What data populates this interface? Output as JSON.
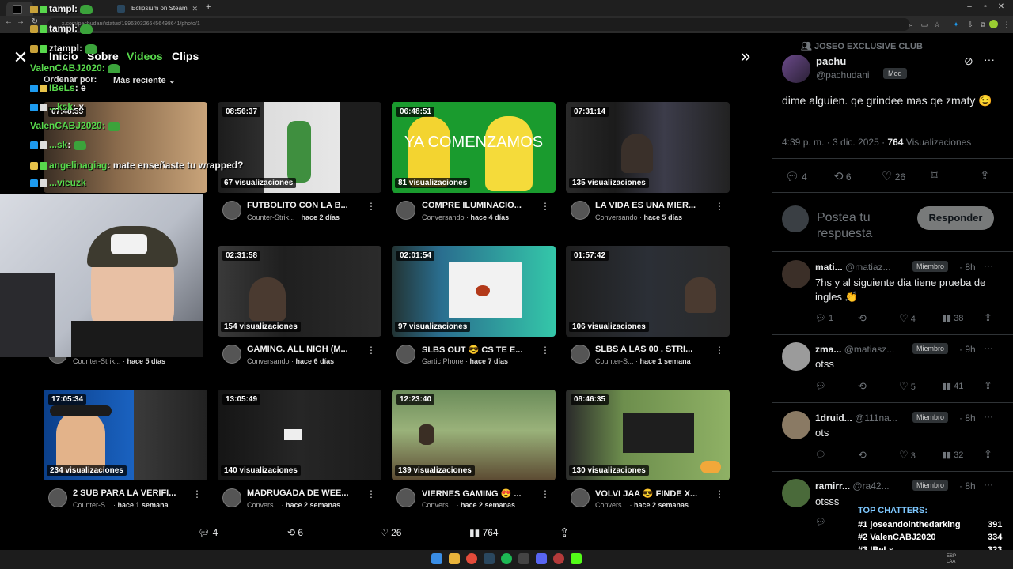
{
  "browser": {
    "tabs": [
      {
        "label": "...",
        "active": true
      },
      {
        "label": "Eclipsium on Steam",
        "active": false
      }
    ],
    "url": "x.com/pachudani/status/1996303266456498641/photo/1",
    "new_tab": "+"
  },
  "overlay": {
    "nav_tabs": [
      "Inicio",
      "Sobre",
      "Videos",
      "Clips"
    ],
    "active_tab": "Videos",
    "sort_label": "Ordenar por:",
    "sort_value": "Más reciente",
    "videos": [
      {
        "duration": "07:48:55",
        "views": "",
        "title": "",
        "channel": "",
        "age": ""
      },
      {
        "duration": "08:56:37",
        "views": "67 visualizaciones",
        "title": "FUTBOLITO CON LA B...",
        "channel": "Counter-Strik...",
        "age": "hace 2 días"
      },
      {
        "duration": "06:48:51",
        "views": "81 visualizaciones",
        "title": "COMPRE ILUMINACIO...",
        "channel": "Conversando",
        "age": "hace 4 días",
        "overlay_text": "YA COMENZAMOS"
      },
      {
        "duration": "07:31:14",
        "views": "135 visualizaciones",
        "title": "LA VIDA ES UNA MIER...",
        "channel": "Conversando",
        "age": "hace 5 días"
      },
      {
        "duration": "",
        "views": "",
        "title": "",
        "channel": "Counter-Strik...",
        "age": "hace 5 días"
      },
      {
        "duration": "02:31:58",
        "views": "154 visualizaciones",
        "title": "GAMING. ALL NIGH (M...",
        "channel": "Conversando",
        "age": "hace 6 días"
      },
      {
        "duration": "02:01:54",
        "views": "97 visualizaciones",
        "title": "SLBS OUT 😎 CS TE E...",
        "channel": "Gartic Phone",
        "age": "hace 7 días"
      },
      {
        "duration": "01:57:42",
        "views": "106 visualizaciones",
        "title": "SLBS A LAS 00 . STRI...",
        "channel": "Counter-S...",
        "age": "hace 1 semana"
      },
      {
        "duration": "17:05:34",
        "views": "234 visualizaciones",
        "title": "2 SUB PARA LA VERIFI...",
        "channel": "Counter-S...",
        "age": "hace 1 semana"
      },
      {
        "duration": "13:05:49",
        "views": "140 visualizaciones",
        "title": "MADRUGADA DE WEE...",
        "channel": "Convers...",
        "age": "hace 2 semanas"
      },
      {
        "duration": "12:23:40",
        "views": "139 visualizaciones",
        "title": "VIERNES GAMING 😍 ...",
        "channel": "Convers...",
        "age": "hace 2 semanas"
      },
      {
        "duration": "08:46:35",
        "views": "130 visualizaciones",
        "title": "VOLVI JAA 😎 FINDE X...",
        "channel": "Convers...",
        "age": "hace 2 semanas"
      }
    ]
  },
  "chat": [
    {
      "user": "tampl",
      "text": ":"
    },
    {
      "user": "tampl",
      "text": ":"
    },
    {
      "user": "ztampl",
      "text": ":"
    },
    {
      "user": "ValenCABJ2020",
      "text": ":"
    },
    {
      "user": "IBeLs",
      "text": ": e"
    },
    {
      "user": "...ksk",
      "text": ": x"
    },
    {
      "user": "ValenCABJ2020",
      "text": ":"
    },
    {
      "user": "...sk",
      "text": ":"
    },
    {
      "user": "angelinagiag",
      "text": ": mate enseñaste tu wrapped?"
    },
    {
      "user": "...vieuzk",
      "text": ""
    }
  ],
  "post": {
    "community": "JOSEO EXCLUSIVE CLUB",
    "author_name": "pachu",
    "author_handle": "@pachudani",
    "author_badge": "Mod",
    "text": "dime alguien. qe grindee mas qe zmaty 😉",
    "timestamp": "4:39 p. m. · 3 dic. 2025 ·",
    "views_count": "764",
    "views_label": "Visualizaciones",
    "replies": "4",
    "reposts": "6",
    "likes": "26",
    "reply_placeholder": "Postea tu respuesta",
    "reply_button": "Responder"
  },
  "replies": [
    {
      "name": "mati...",
      "handle": "@matiaz...",
      "badge": "Miembro",
      "time": "· 8h",
      "text": "7hs y al siguiente dia tiene prueba de ingles 👏",
      "replies": "1",
      "reposts": "",
      "likes": "4",
      "views": "38"
    },
    {
      "name": "zma...",
      "handle": "@matiasz...",
      "badge": "Miembro",
      "time": "· 9h",
      "text": "otss",
      "replies": "",
      "reposts": "",
      "likes": "5",
      "views": "41"
    },
    {
      "name": "1druid...",
      "handle": "@111na...",
      "badge": "Miembro",
      "time": "· 8h",
      "text": "ots",
      "replies": "",
      "reposts": "",
      "likes": "3",
      "views": "32"
    },
    {
      "name": "ramirr...",
      "handle": "@ra42...",
      "badge": "Miembro",
      "time": "· 8h",
      "text": "otsss",
      "replies": "",
      "reposts": "",
      "likes": "",
      "views": ""
    }
  ],
  "bottom_bar": {
    "replies": "4",
    "reposts": "6",
    "likes": "26",
    "views": "764"
  },
  "top_chatters": {
    "title": "TOP CHATTERS:",
    "entries": [
      {
        "rank": "#1",
        "name": "joseandointhedarking",
        "count": "391"
      },
      {
        "rank": "#2",
        "name": "ValenCABJ2020",
        "count": "334"
      },
      {
        "rank": "#3",
        "name": "IBeLs",
        "count": "323"
      }
    ]
  },
  "taskbar": {
    "lang": "ESP LAA",
    "time": "",
    "date": ""
  },
  "colors": {
    "accent_green": "#58d84c",
    "x_blue": "#1d9bf0",
    "border": "#2f3336",
    "muted": "#71767b"
  }
}
